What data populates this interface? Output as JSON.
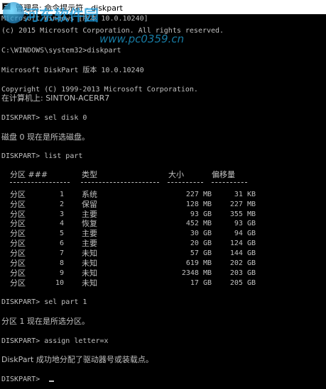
{
  "window": {
    "title": "管理员: 命令提示符 - diskpart"
  },
  "watermark": {
    "brand": "河东软件园",
    "url": "www.pc0359.cn"
  },
  "console": {
    "version_line": "Microsoft Windows [版本 10.0.10240]",
    "copyright_line": "(c) 2015 Microsoft Corporation. All rights reserved.",
    "cmd1": "C:\\WINDOWS\\system32>diskpart",
    "dp_version": "Microsoft DiskPart 版本 10.0.10240",
    "dp_copyright": "Copyright (C) 1999-2013 Microsoft Corporation.",
    "computer_line": "在计算机上: SINTON-ACERR7",
    "cmd_sel_disk": "DISKPART> sel disk 0",
    "disk_selected": "磁盘 0 现在是所选磁盘。",
    "cmd_list_part": "DISKPART> list part",
    "cmd_sel_part": "DISKPART> sel part 1",
    "part_selected": "分区 1 现在是所选分区。",
    "cmd_assign": "DISKPART> assign letter=x",
    "assign_result": "DiskPart 成功地分配了驱动器号或装载点。",
    "prompt": "DISKPART> "
  },
  "partition_table": {
    "headers": {
      "partition": "分区 ###",
      "type": "类型",
      "size": "大小",
      "offset": "偏移量"
    },
    "rows": [
      {
        "label": "分区",
        "num": "1",
        "type": "系统",
        "size": "227 MB",
        "offset": "31 KB"
      },
      {
        "label": "分区",
        "num": "2",
        "type": "保留",
        "size": "128 MB",
        "offset": "227 MB"
      },
      {
        "label": "分区",
        "num": "3",
        "type": "主要",
        "size": "93 GB",
        "offset": "355 MB"
      },
      {
        "label": "分区",
        "num": "4",
        "type": "恢复",
        "size": "452 MB",
        "offset": "93 GB"
      },
      {
        "label": "分区",
        "num": "5",
        "type": "主要",
        "size": "30 GB",
        "offset": "94 GB"
      },
      {
        "label": "分区",
        "num": "6",
        "type": "主要",
        "size": "20 GB",
        "offset": "124 GB"
      },
      {
        "label": "分区",
        "num": "7",
        "type": "未知",
        "size": "57 GB",
        "offset": "144 GB"
      },
      {
        "label": "分区",
        "num": "8",
        "type": "未知",
        "size": "619 MB",
        "offset": "202 GB"
      },
      {
        "label": "分区",
        "num": "9",
        "type": "未知",
        "size": "2348 MB",
        "offset": "203 GB"
      },
      {
        "label": "分区",
        "num": "10",
        "type": "未知",
        "size": "17 GB",
        "offset": "205 GB"
      }
    ]
  }
}
